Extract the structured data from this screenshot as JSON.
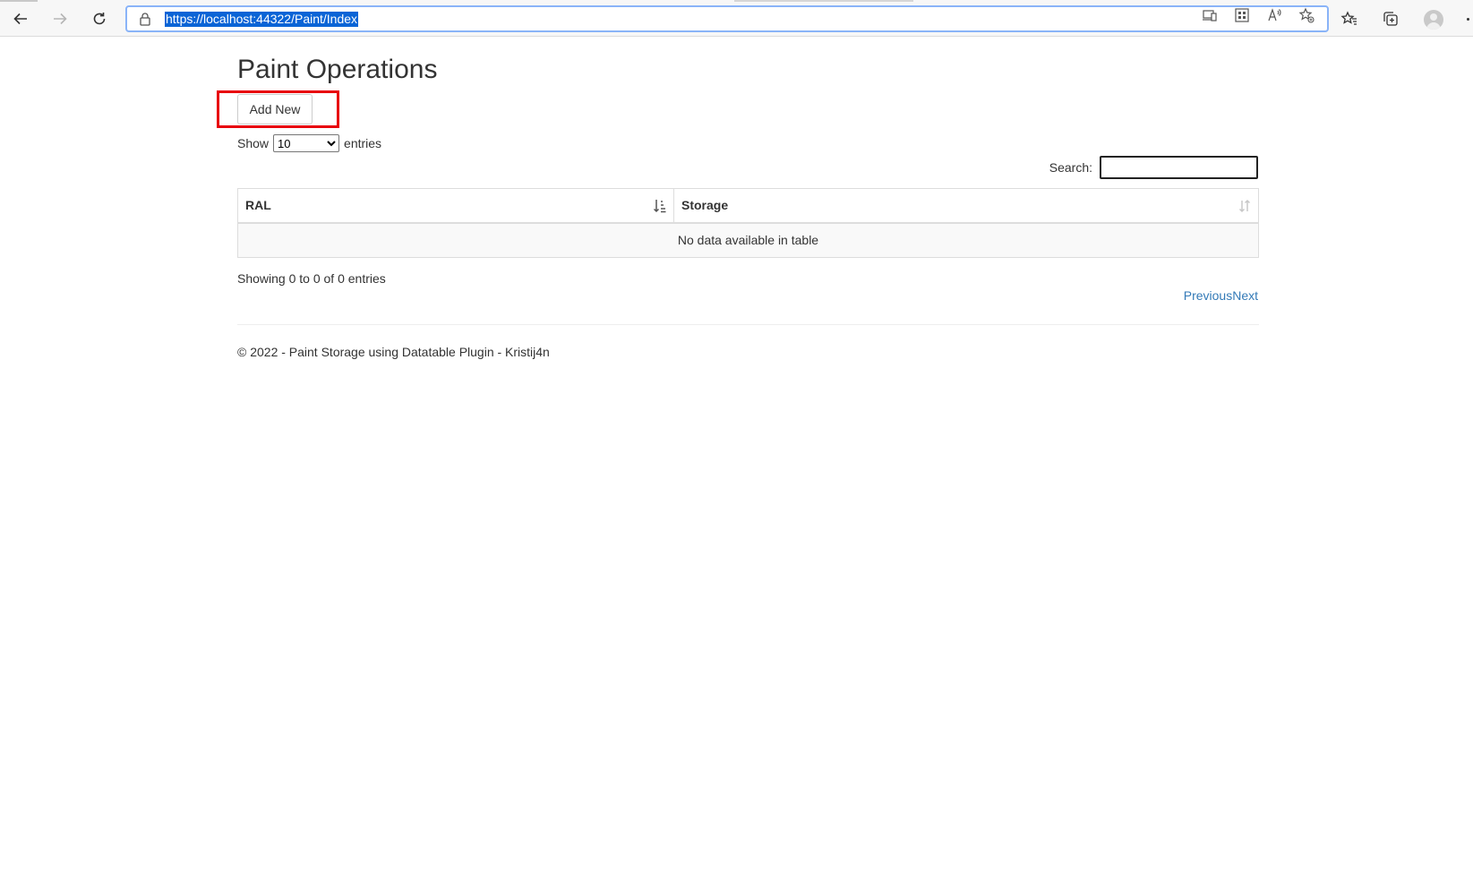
{
  "browser": {
    "url": "https://localhost:44322/Paint/Index",
    "url_icons": [
      "device-icon",
      "apps-icon",
      "read-aloud-icon",
      "add-favorite-icon"
    ],
    "toolbar_icons": [
      "favorites-icon",
      "collections-icon",
      "profile-avatar",
      "more-icon"
    ]
  },
  "page": {
    "title": "Paint Operations",
    "add_button": "Add New",
    "length": {
      "show_label": "Show",
      "selected": "10",
      "entries_label": "entries"
    },
    "search": {
      "label": "Search:",
      "value": ""
    },
    "table": {
      "columns": [
        "RAL",
        "Storage"
      ],
      "empty_message": "No data available in table"
    },
    "info": "Showing 0 to 0 of 0 entries",
    "paging": {
      "previous": "Previous",
      "next": "Next"
    },
    "footer": "© 2022 - Paint Storage using Datatable Plugin - Kristij4n"
  },
  "colors": {
    "link": "#337ab7",
    "highlight": "#e8000b",
    "url_selection": "#0a64d6"
  }
}
